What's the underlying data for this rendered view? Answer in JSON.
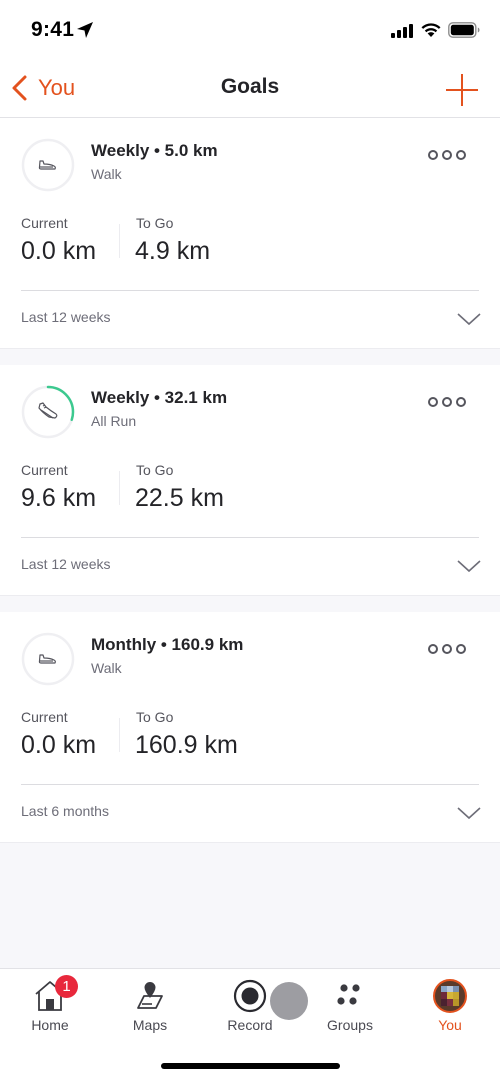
{
  "status_bar": {
    "time": "9:41",
    "icons": [
      "location-arrow-icon",
      "signal-icon",
      "wifi-icon",
      "battery-icon"
    ]
  },
  "nav": {
    "back_label": "You",
    "title": "Goals",
    "add_icon": "plus-icon"
  },
  "colors": {
    "accent": "#e3521e",
    "progress": "#3cc98f",
    "badge": "#e8283c",
    "text_primary": "#242428",
    "text_secondary": "#6d6d78"
  },
  "goals": [
    {
      "title": "Weekly • 5.0 km",
      "sport": "Walk",
      "icon": "walk-shoe-icon",
      "progress": 0.0,
      "current_label": "Current",
      "current_value": "0.0 km",
      "togo_label": "To Go",
      "togo_value": "4.9 km",
      "period": "Last 12 weeks"
    },
    {
      "title": "Weekly • 32.1 km",
      "sport": "All Run",
      "icon": "run-shoe-icon",
      "progress": 0.3,
      "current_label": "Current",
      "current_value": "9.6 km",
      "togo_label": "To Go",
      "togo_value": "22.5 km",
      "period": "Last 12 weeks"
    },
    {
      "title": "Monthly • 160.9 km",
      "sport": "Walk",
      "icon": "walk-shoe-icon",
      "progress": 0.0,
      "current_label": "Current",
      "current_value": "0.0 km",
      "togo_label": "To Go",
      "togo_value": "160.9 km",
      "period": "Last 6 months"
    }
  ],
  "tabs": [
    {
      "label": "Home",
      "icon": "home-icon",
      "badge": "1",
      "active": false
    },
    {
      "label": "Maps",
      "icon": "maps-icon",
      "active": false
    },
    {
      "label": "Record",
      "icon": "record-icon",
      "active": false
    },
    {
      "label": "Groups",
      "icon": "groups-icon",
      "active": false
    },
    {
      "label": "You",
      "icon": "avatar",
      "active": true
    }
  ]
}
